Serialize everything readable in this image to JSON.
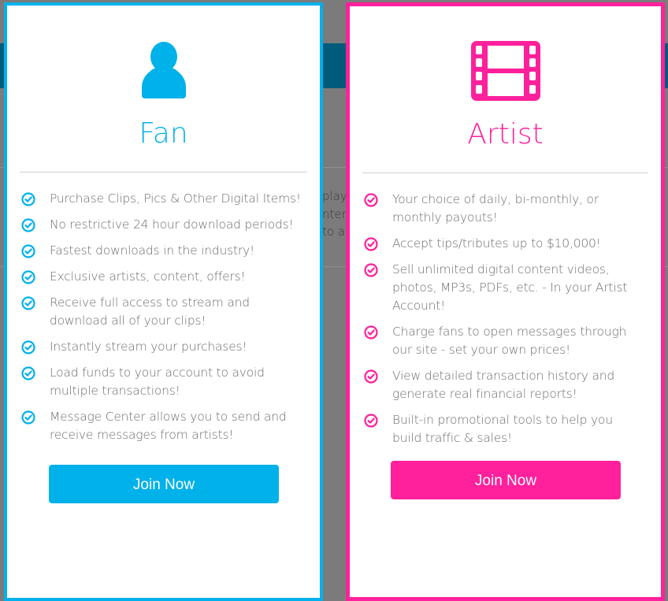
{
  "colors": {
    "fan": "#00b1ea",
    "artist": "#ff209b",
    "background": "#7b7b7b",
    "band": "#005b7a"
  },
  "background_fragments": [
    "play t",
    "nterp",
    "to a"
  ],
  "fan": {
    "icon": "user-icon",
    "title": "Fan",
    "features": [
      "Purchase Clips, Pics & Other Digital Items!",
      "No restrictive 24 hour download periods!",
      "Fastest downloads in the industry!",
      "Exclusive artists, content, offers!",
      "Receive full access to stream and download all of your clips!",
      "Instantly stream your purchases!",
      "Load funds to your account to avoid multiple transactions!",
      "Message Center allows you to send and receive messages from artists!"
    ],
    "button": "Join Now"
  },
  "artist": {
    "icon": "film-icon",
    "title": "Artist",
    "features": [
      "Your choice of daily, bi-monthly, or monthly payouts!",
      "Accept tips/tributes up to $10,000!",
      "Sell unlimited digital content videos, photos, MP3s, PDFs, etc. - In your Artist Account!",
      "Charge fans to open messages through our site - set your own prices!",
      "View detailed transaction history and generate real financial reports!",
      "Built-in promotional tools to help you build traffic & sales!"
    ],
    "button": "Join Now"
  }
}
